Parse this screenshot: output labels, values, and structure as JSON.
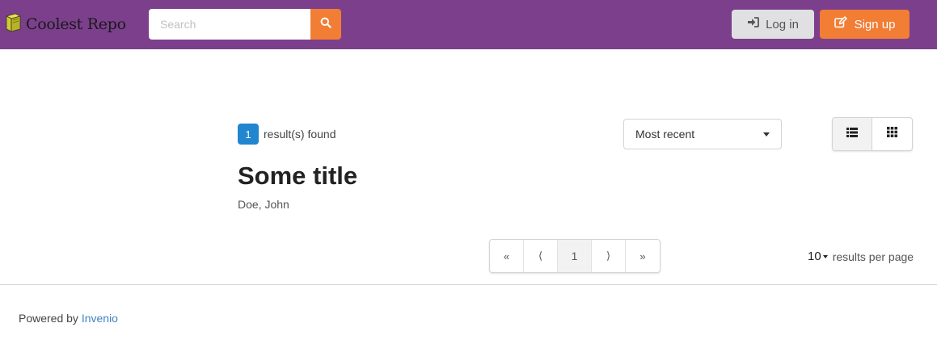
{
  "header": {
    "brand": "Coolest Repo",
    "search_placeholder": "Search",
    "login_label": "Log in",
    "signup_label": "Sign up",
    "navbar_color": "#7b3f8c",
    "accent_color": "#f27d35"
  },
  "results": {
    "count": "1",
    "count_label": "result(s) found",
    "sort_selected": "Most recent",
    "layout_options": [
      "list",
      "grid"
    ],
    "layout_selected": "list",
    "items": [
      {
        "title": "Some title",
        "authors": "Doe, John"
      }
    ]
  },
  "pagination": {
    "first": "«",
    "prev": "⟨",
    "current": "1",
    "next": "⟩",
    "last": "»"
  },
  "per_page": {
    "value": "10",
    "label": "results per page"
  },
  "footer": {
    "prefix": "Powered by",
    "link_text": "Invenio"
  },
  "icons": {
    "logo": "book-icon",
    "search": "search-icon",
    "login": "sign-in-icon",
    "signup": "edit-icon",
    "list": "list-icon",
    "grid": "grid-icon"
  },
  "colors": {
    "badge": "#2185d0",
    "link": "#4183c4"
  }
}
